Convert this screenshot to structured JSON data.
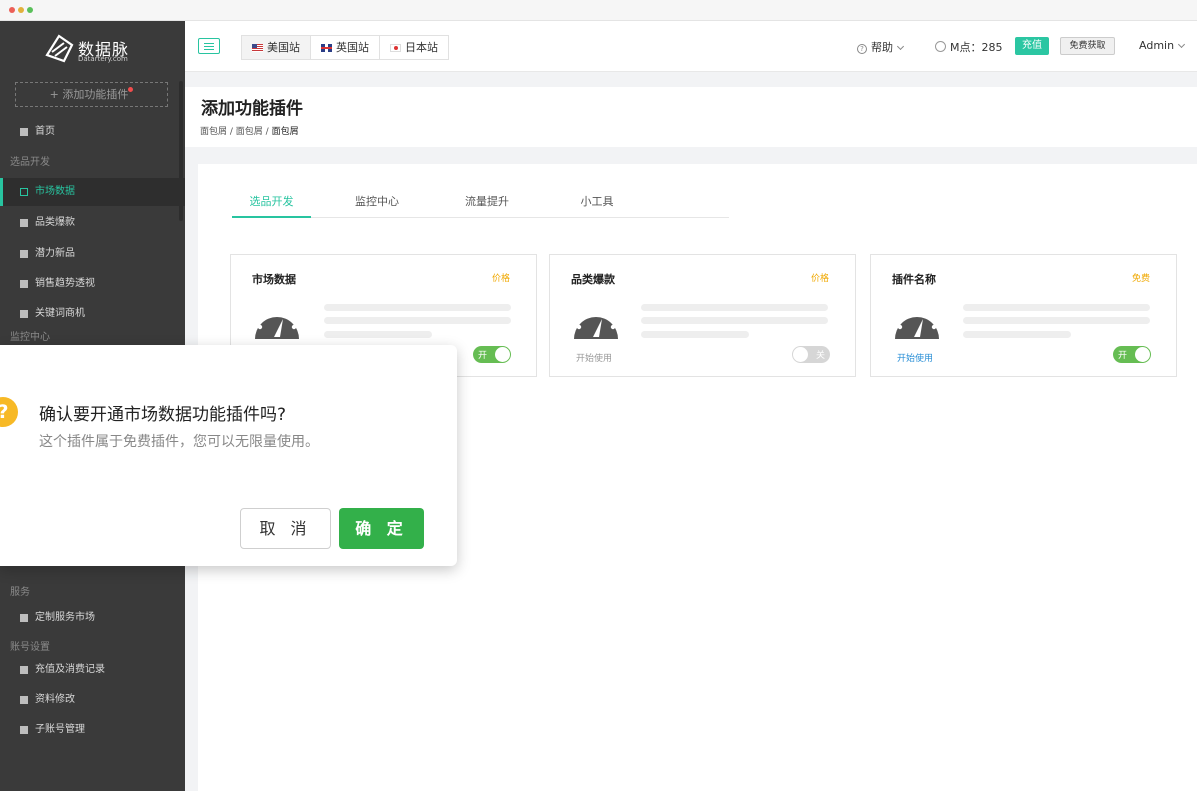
{
  "brand": {
    "name": "数据脉",
    "domain": "Datartery.com"
  },
  "sidebar": {
    "add_plugin": "+ 添加功能插件",
    "home": "首页",
    "groups": {
      "product_dev": "选品开发",
      "monitor": "监控中心",
      "service": "服务",
      "account": "账号设置"
    },
    "product_items": [
      "市场数据",
      "品类爆款",
      "潜力新品",
      "销售趋势透视",
      "关键词商机"
    ],
    "service_items": [
      "定制服务市场"
    ],
    "account_items": [
      "充值及消费记录",
      "资料修改",
      "子账号管理"
    ]
  },
  "header": {
    "sites": [
      "美国站",
      "英国站",
      "日本站"
    ],
    "active_site": "美国站",
    "help": "帮助",
    "mpoints_label": "M点：",
    "mpoints_value": "285",
    "recharge": "充值",
    "free_get": "免费获取",
    "user": "Admin"
  },
  "page": {
    "title": "添加功能插件",
    "breadcrumb": [
      "面包屑",
      "面包屑",
      "面包屑"
    ]
  },
  "tabs": [
    "选品开发",
    "监控中心",
    "流量提升",
    "小工具"
  ],
  "active_tab": "选品开发",
  "plugins": [
    {
      "name": "市场数据",
      "tag": "价格",
      "tag_color": "#f0a800",
      "action": "",
      "toggle_on": true,
      "toggle_label": "开"
    },
    {
      "name": "品类爆款",
      "tag": "价格",
      "tag_color": "#f0a800",
      "action": "开始使用",
      "toggle_on": false,
      "toggle_label": "关"
    },
    {
      "name": "插件名称",
      "tag": "免费",
      "tag_color": "#f0a800",
      "action": "开始使用",
      "toggle_on": true,
      "toggle_label": "开"
    }
  ],
  "modal": {
    "icon": "?",
    "title": "确认要开通市场数据功能插件吗?",
    "desc": "这个插件属于免费插件，您可以无限量使用。",
    "cancel": "取 消",
    "ok": "确 定"
  },
  "colors": {
    "accent": "#28c4a0",
    "toggle_on": "#66bd53",
    "ok_button": "#33b04a",
    "tag": "#f0a800",
    "sidebar_bg": "#3a3a3a"
  }
}
